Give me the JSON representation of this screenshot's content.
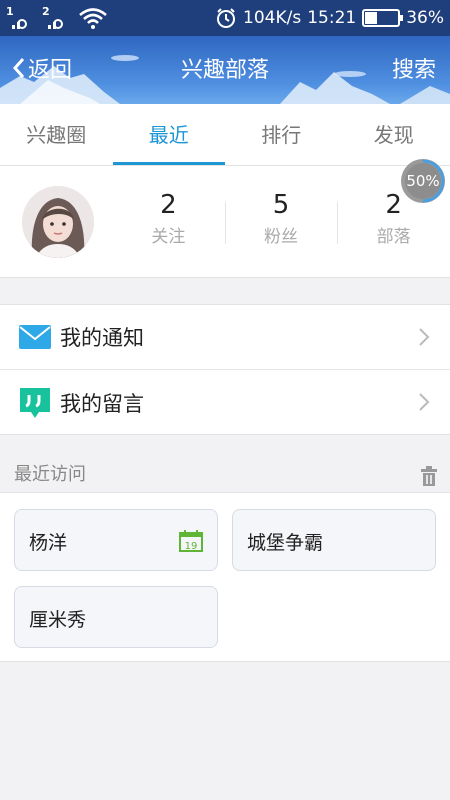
{
  "status_bar": {
    "sim1": "1",
    "sim2": "2",
    "speed": "104K/s",
    "time": "15:21",
    "battery": "36%",
    "battery_level": 0.36
  },
  "nav": {
    "back_label": "返回",
    "title": "兴趣部落",
    "search_label": "搜索"
  },
  "tabs": [
    {
      "label": "兴趣圈",
      "active": false
    },
    {
      "label": "最近",
      "active": true
    },
    {
      "label": "排行",
      "active": false
    },
    {
      "label": "发现",
      "active": false
    }
  ],
  "profile": {
    "stats": [
      {
        "value": "2",
        "label": "关注"
      },
      {
        "value": "5",
        "label": "粉丝"
      },
      {
        "value": "2",
        "label": "部落"
      }
    ],
    "progress_text": "50%",
    "progress_value": 0.5
  },
  "menu": [
    {
      "label": "我的通知",
      "icon": "mail-icon"
    },
    {
      "label": "我的留言",
      "icon": "quote-icon"
    }
  ],
  "recent": {
    "title": "最近访问",
    "items": [
      {
        "label": "杨洋",
        "icon": "calendar-icon",
        "icon_text": "19"
      },
      {
        "label": "城堡争霸"
      },
      {
        "label": "厘米秀"
      }
    ]
  },
  "colors": {
    "status_bar": "#1f3f7c",
    "nav_bar": "#3f7fd6",
    "accent": "#1e96d6",
    "mail_icon": "#2ea8e6",
    "quote_icon": "#18c29c",
    "calendar_icon": "#5fb535"
  }
}
